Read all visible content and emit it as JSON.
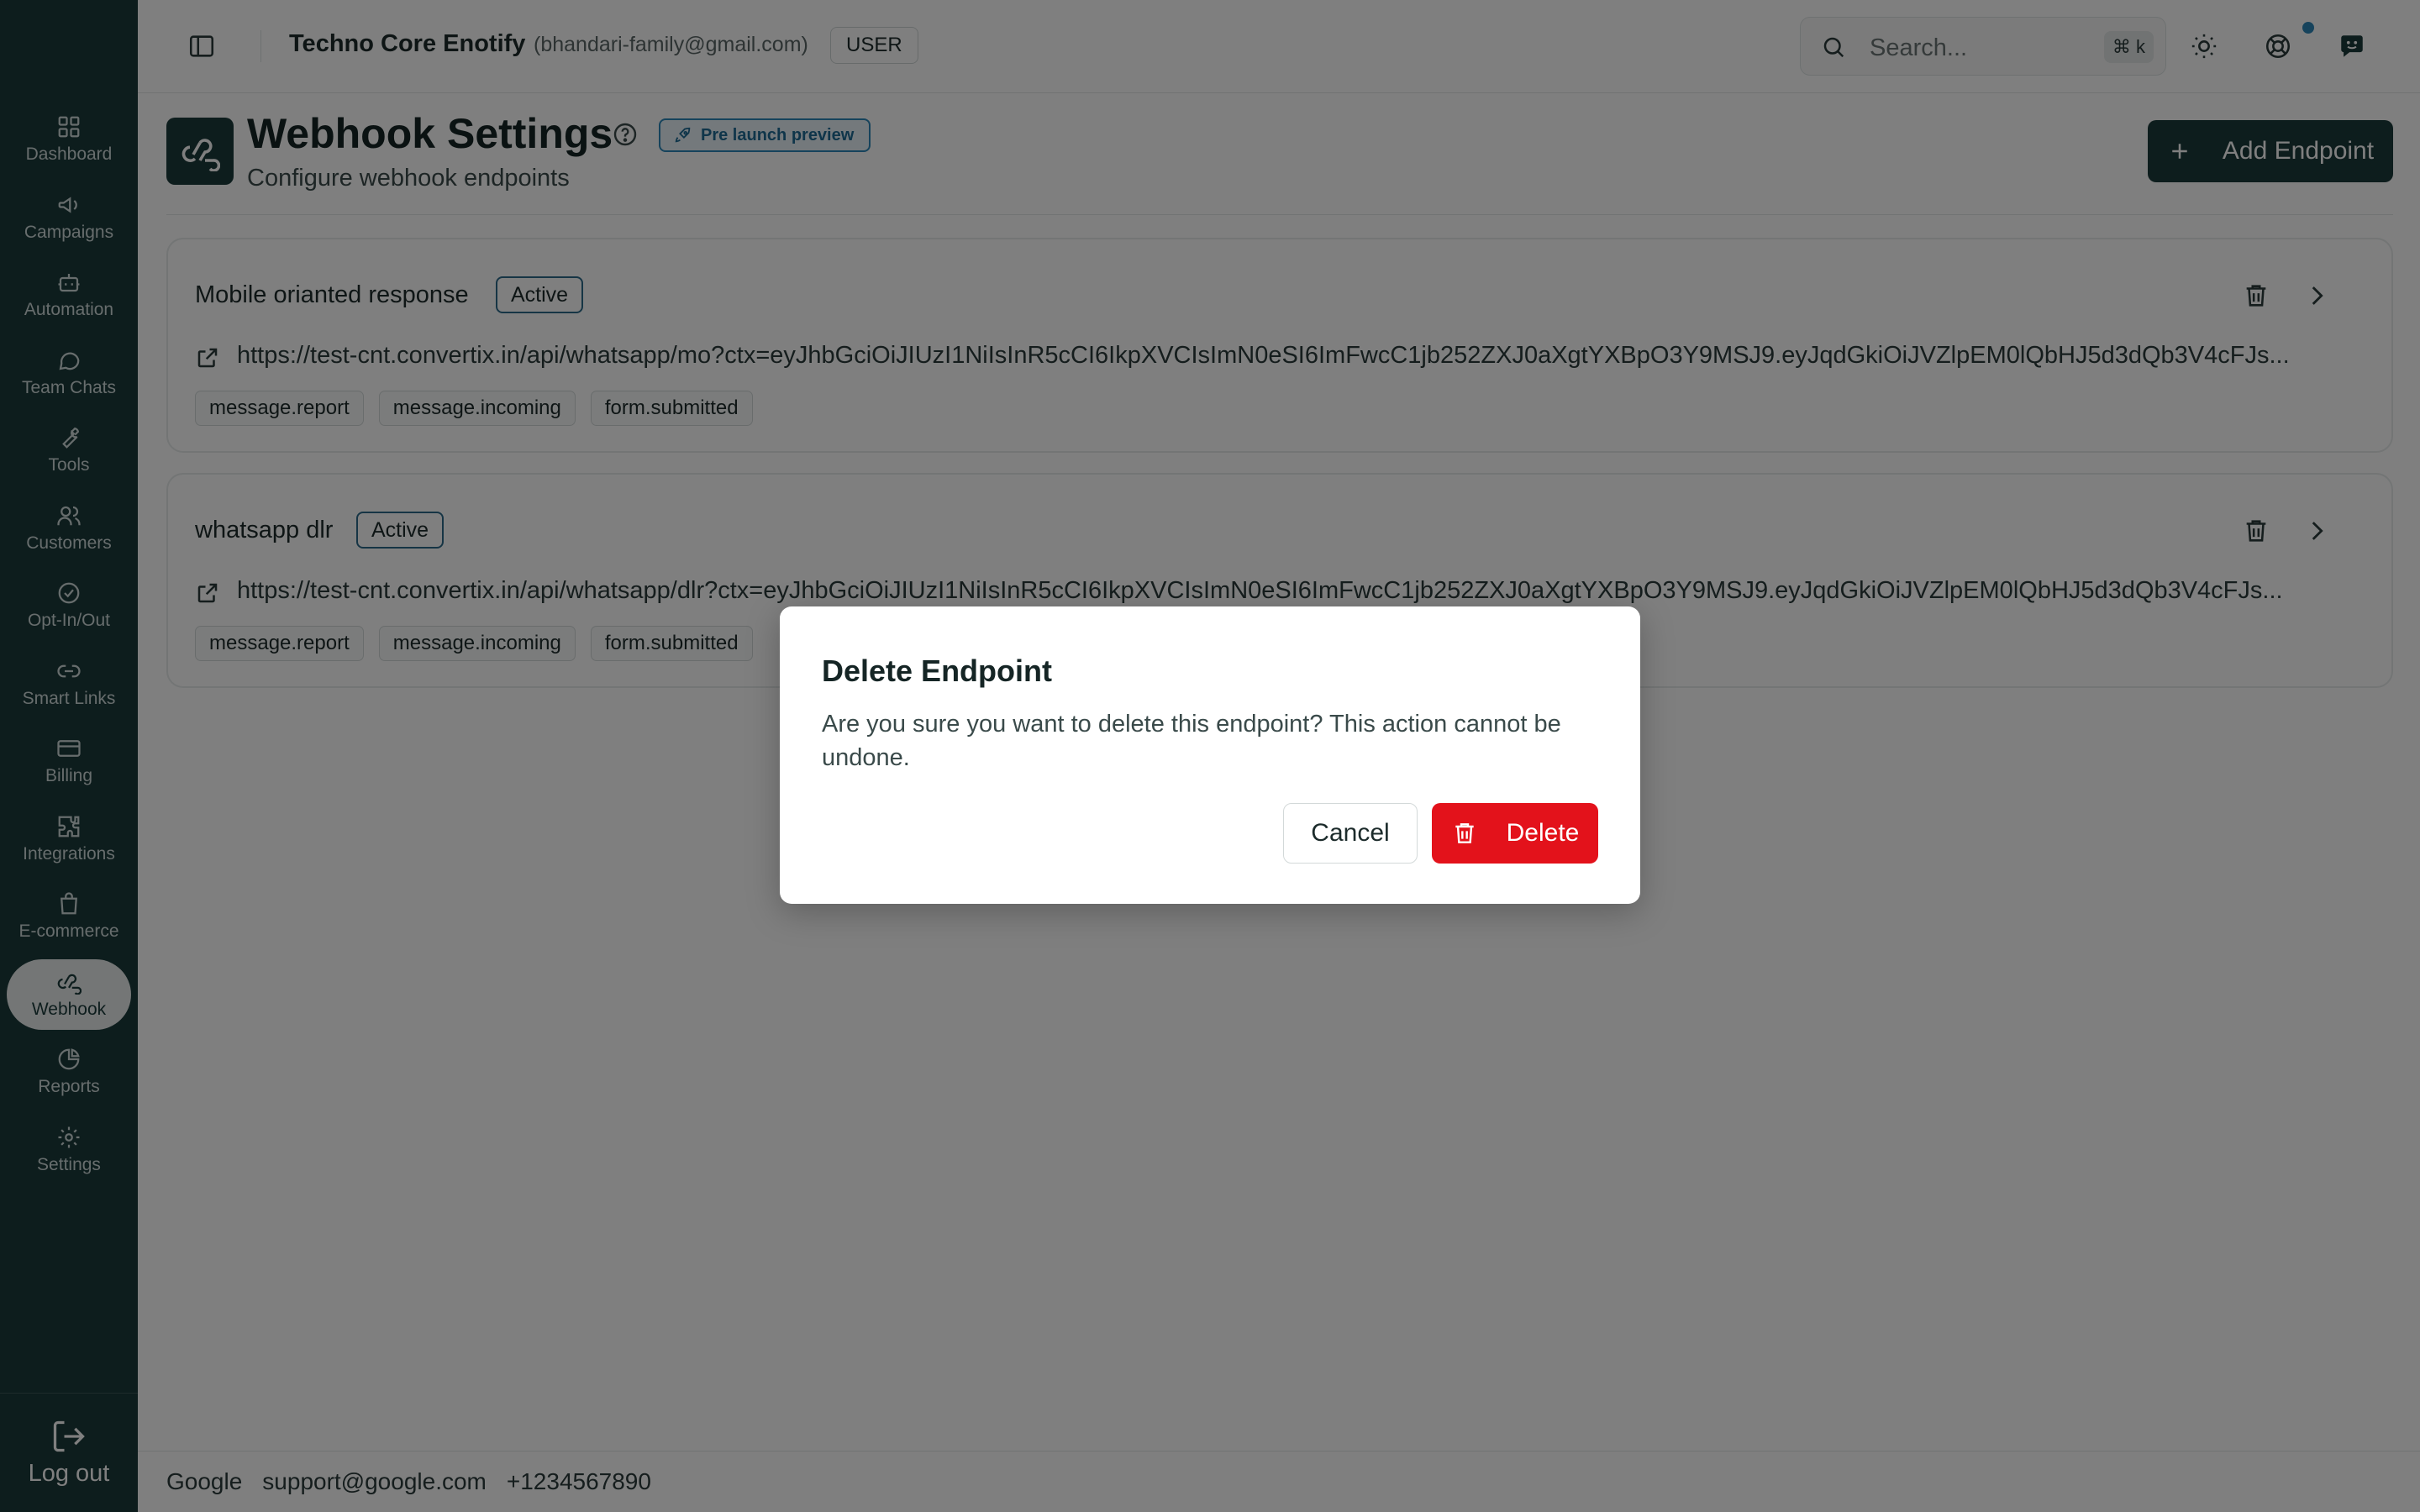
{
  "sidebar": {
    "items": [
      {
        "label": "Dashboard",
        "icon": "dashboard-icon"
      },
      {
        "label": "Campaigns",
        "icon": "megaphone-icon"
      },
      {
        "label": "Automation",
        "icon": "bot-icon"
      },
      {
        "label": "Team Chats",
        "icon": "chat-bubble-icon"
      },
      {
        "label": "Tools",
        "icon": "wrench-icon"
      },
      {
        "label": "Customers",
        "icon": "users-icon"
      },
      {
        "label": "Opt-In/Out",
        "icon": "check-circle-icon"
      },
      {
        "label": "Smart Links",
        "icon": "link-icon"
      },
      {
        "label": "Billing",
        "icon": "credit-card-icon"
      },
      {
        "label": "Integrations",
        "icon": "puzzle-icon"
      },
      {
        "label": "E-commerce",
        "icon": "shopping-bag-icon"
      },
      {
        "label": "Webhook",
        "icon": "webhook-icon",
        "active": true
      },
      {
        "label": "Reports",
        "icon": "pie-chart-icon"
      },
      {
        "label": "Settings",
        "icon": "gear-icon"
      }
    ],
    "logout_label": "Log out"
  },
  "topbar": {
    "org_name": "Techno Core Enotify",
    "org_email": "(bhandari-family@gmail.com)",
    "role": "USER",
    "search_placeholder": "Search...",
    "search_shortcut": "⌘ k"
  },
  "page": {
    "title": "Webhook Settings",
    "badge": "Pre launch preview",
    "subtitle": "Configure webhook endpoints",
    "add_button": "Add Endpoint"
  },
  "endpoints": [
    {
      "name": "Mobile orianted response",
      "status": "Active",
      "url": "https://test-cnt.convertix.in/api/whatsapp/mo?ctx=eyJhbGciOiJIUzI1NiIsInR5cCI6IkpXVCIsImN0eSI6ImFwcC1jb252ZXJ0aXgtYXBpO3Y9MSJ9.eyJqdGkiOiJVZlpEM0lQbHJ5d3dQb3V4cFJs...",
      "events": [
        "message.report",
        "message.incoming",
        "form.submitted"
      ]
    },
    {
      "name": "whatsapp dlr",
      "status": "Active",
      "url": "https://test-cnt.convertix.in/api/whatsapp/dlr?ctx=eyJhbGciOiJIUzI1NiIsInR5cCI6IkpXVCIsImN0eSI6ImFwcC1jb252ZXJ0aXgtYXBpO3Y9MSJ9.eyJqdGkiOiJVZlpEM0lQbHJ5d3dQb3V4cFJs...",
      "events": [
        "message.report",
        "message.incoming",
        "form.submitted"
      ]
    }
  ],
  "footer": {
    "company": "Google",
    "email": "support@google.com",
    "phone": "+1234567890"
  },
  "modal": {
    "title": "Delete Endpoint",
    "body": "Are you sure you want to delete this endpoint? This action cannot be undone.",
    "cancel_label": "Cancel",
    "delete_label": "Delete"
  },
  "colors": {
    "sidebar_bg": "#1b3a3a",
    "accent_blue": "#2c86b8",
    "danger": "#e3121b"
  }
}
